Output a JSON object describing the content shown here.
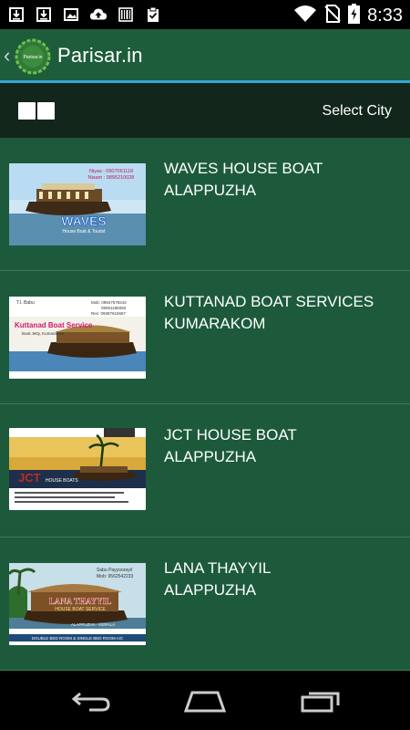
{
  "status_bar": {
    "time": "8:33",
    "icons": [
      "download-icon",
      "download-icon",
      "image-icon",
      "cloud-upload-icon",
      "barcode-icon",
      "clipboard-check-icon",
      "wifi-icon",
      "no-sim-icon",
      "battery-charging-icon"
    ]
  },
  "action_bar": {
    "title": "Parisar.in",
    "logo_text": "Parisar.in",
    "accent_color": "#35a6d6"
  },
  "toolbar": {
    "select_city_label": "Select City"
  },
  "listings": [
    {
      "name": "WAVES HOUSE BOAT",
      "city": "ALAPPUZHA",
      "card": {
        "contact_1": "Niyas : 0907061118",
        "contact_2": "Nisam : 9895210028",
        "brand": "WAVES",
        "tagline": "House Boat & Tourist"
      }
    },
    {
      "name": "KUTTANAD BOAT SERVICES",
      "city": "KUMARAKOM",
      "card": {
        "owner": "T.I. Babu",
        "phones": "Mob: 09947578242",
        "phones_2": "09061186082",
        "phones_3": "Res: 09387615667",
        "brand": "Kuttanad Boat Service",
        "address": "Boat Jetty, Kumarakom"
      }
    },
    {
      "name": "JCT HOUSE BOAT",
      "city": "ALAPPUZHA",
      "card": {
        "brand": "JCT",
        "subtitle": "HOUSE BOATS"
      }
    },
    {
      "name": "LANA THAYYIL",
      "city": "ALAPPUZHA",
      "card": {
        "owner": "Sabu Payyoorayil",
        "mobile": "Mob: 9562542233",
        "brand": "LANA THAYYIL",
        "subtitle": "HOUSE BOAT SERVICE",
        "place": "ALAPPUZHA - KERALA",
        "footer": "DOUBLE BED ROOM & SINGLE BED ROOM A/C"
      }
    }
  ],
  "nav_bar": {
    "buttons": [
      "back-icon",
      "home-icon",
      "recents-icon"
    ]
  }
}
